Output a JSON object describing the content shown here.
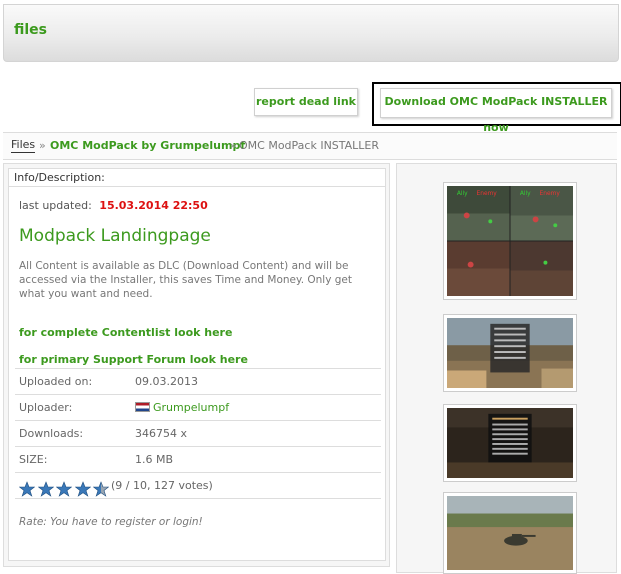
{
  "header": {
    "title": "files"
  },
  "buttons": {
    "report": "report dead link",
    "download": "Download OMC ModPack INSTALLER now"
  },
  "breadcrumb": {
    "root": "Files",
    "sep": "»",
    "parent": "OMC ModPack by Grumpelumpf",
    "current": "OMC ModPack INSTALLER"
  },
  "info": {
    "heading": "Info/Description:",
    "last_updated_label": "last updated:",
    "last_updated_value": "15.03.2014 22:50",
    "title": "Modpack Landingpage",
    "description": "All Content is available as DLC (Download Content) and will be accessed via the Installer, this saves Time and Money. Only get what you want and need.",
    "link_contentlist": "for complete Contentlist look here",
    "link_forum": "for primary Support Forum look here",
    "rows": [
      {
        "label": "Uploaded on:",
        "value": "09.03.2013"
      },
      {
        "label": "Uploader:",
        "value": "Grumpelumpf"
      },
      {
        "label": "Downloads:",
        "value": "346754 x"
      },
      {
        "label": "SIZE:",
        "value": "1.6 MB"
      }
    ],
    "rating": {
      "text": "(9 / 10, 127 votes)",
      "score": 9,
      "max": 10,
      "stars_shown": 5
    },
    "rate_note": "Rate: You have to register or login!"
  },
  "thumbnails": [
    {
      "name": "screenshot-1",
      "overlay": [
        "Ally",
        "Enemy",
        "Ally",
        "Enemy"
      ]
    },
    {
      "name": "screenshot-2"
    },
    {
      "name": "screenshot-3"
    },
    {
      "name": "screenshot-4"
    }
  ],
  "colors": {
    "accent": "#3c9a1e",
    "date": "#dd1111",
    "star": "#3a78b8"
  }
}
